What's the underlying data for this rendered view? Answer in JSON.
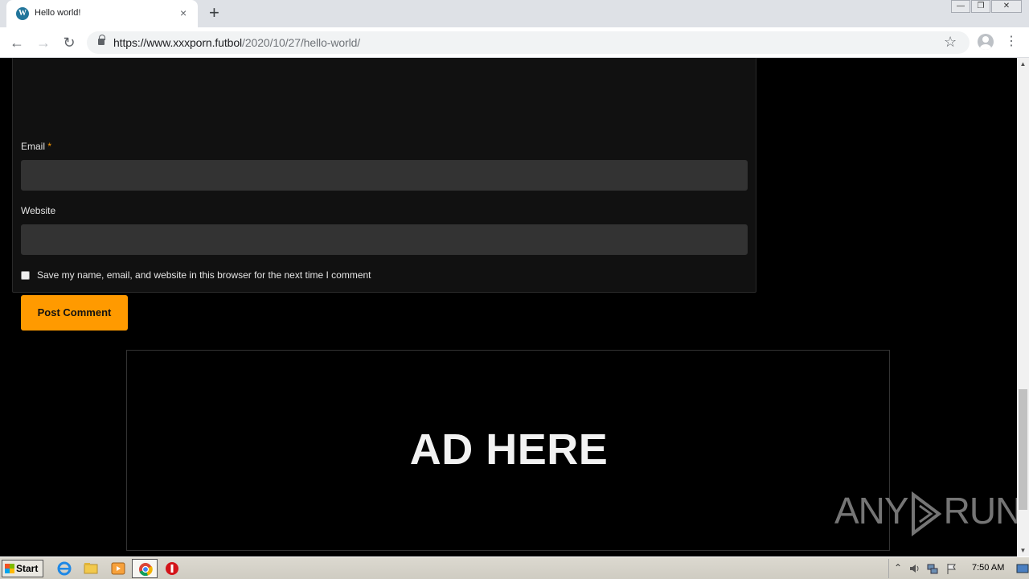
{
  "browser": {
    "tab_title": "Hello world!",
    "favicon_letter": "W",
    "tab_close": "×",
    "new_tab": "+",
    "url_host": "https://www.xxxporn.futbol",
    "url_path": "/2020/10/27/hello-world/",
    "back": "←",
    "forward": "→",
    "reload": "↻",
    "star": "☆",
    "menu": "⋮",
    "win_minimize": "—",
    "win_restore": "❐",
    "win_close": "✕"
  },
  "form": {
    "email_label": "Email",
    "required_mark": "*",
    "website_label": "Website",
    "save_label": "Save my name, email, and website in this browser for the next time I comment",
    "post_button": "Post Comment"
  },
  "ad": {
    "text": "AD HERE"
  },
  "watermark": {
    "left": "ANY",
    "right": "RUN"
  },
  "scrollbar": {
    "up": "▲",
    "down": "▼"
  },
  "taskbar": {
    "start_label": "Start",
    "clock": "7:50 AM",
    "tray_arrow": "⌃"
  },
  "colors": {
    "accent": "#ff9a00",
    "page_bg": "#000000",
    "form_bg": "#111111",
    "input_bg": "#333333"
  }
}
